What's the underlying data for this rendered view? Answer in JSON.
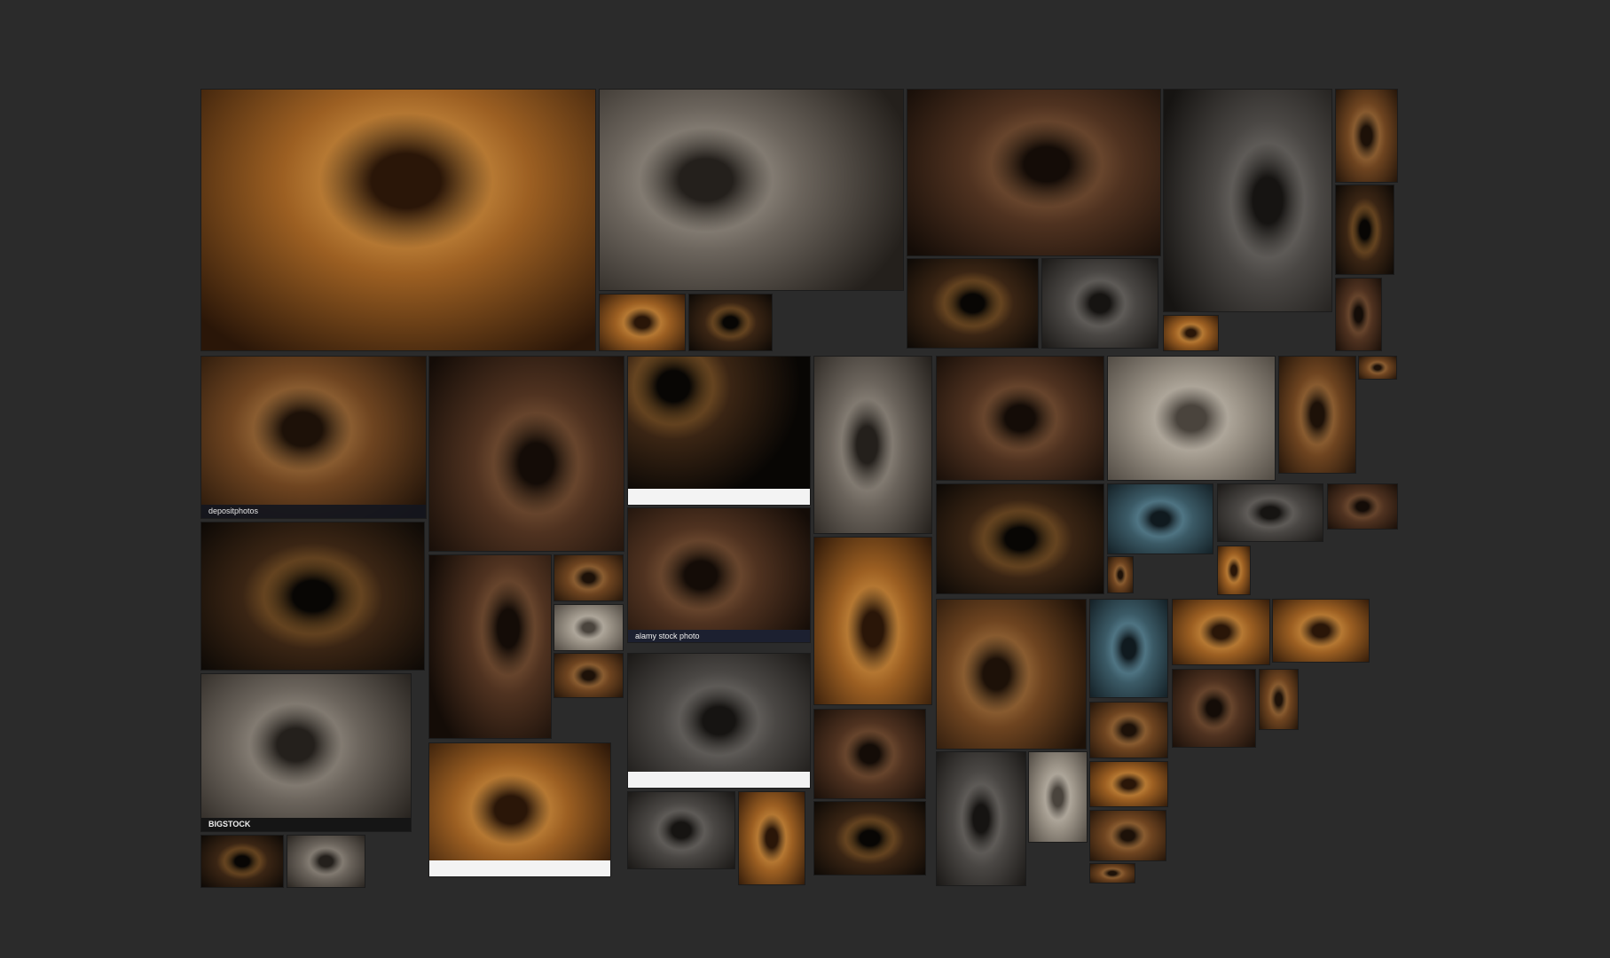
{
  "board": {
    "background": "#2b2b2b",
    "captions": {
      "depositphotos": "depositphotos",
      "alamy": "alamy stock photo",
      "bigstock": "BIGSTOCK"
    }
  },
  "palette": {
    "amber": "#c9822e",
    "ochre": "#8a5a26",
    "shadow": "#141009",
    "stone": "#6d655c",
    "teal": "#3f6a7a"
  }
}
